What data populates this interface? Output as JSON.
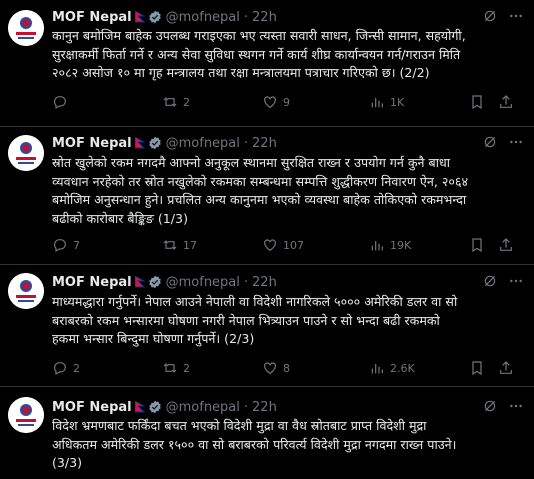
{
  "colors": {
    "background": "#000000",
    "text": "#e7e9ea",
    "muted": "#71767b",
    "divider": "#2f3336",
    "verified": "#829aab"
  },
  "tweets": [
    {
      "name": "MOF Nepal",
      "handle": "@mofnepal",
      "dot": "·",
      "time": "22h",
      "text": "कानुन बमोजिम बाहेक उपलब्ध गराइएका भए त्यस्ता सवारी साधन, जिन्सी सामान, सहयोगी,\nसुरक्षाकर्मी फिर्ता गर्ने र अन्य सेवा सुविधा स्थगन गर्ने कार्य शीघ्र कार्यान्वयन गर्न/गराउन मिति\n२०८२ असोज १० मा गृह मन्त्रालय तथा रक्षा मन्त्रालयमा पत्राचार गरिएको छ। (2/2)",
      "replies": "",
      "reposts": "2",
      "likes": "9",
      "views": "1K"
    },
    {
      "name": "MOF Nepal",
      "handle": "@mofnepal",
      "dot": "·",
      "time": "22h",
      "text": "स्रोत खुलेको रकम नगदमै आफ्नो अनुकूल स्थानमा सुरक्षित राख्न र उपयोग गर्न कुनै बाधा\nव्यवधान नरहेको तर स्रोत नखुलेको रकमका सम्बन्धमा सम्पत्ति शुद्धीकरण निवारण ऐन, २०६४\nबमोजिम अनुसन्धान हुने। प्रचलित अन्य कानुनमा भएको व्यवस्था बाहेक तोकिएको रकमभन्दा\nबढीको कारोबार बैङ्किङ (1/3)",
      "replies": "7",
      "reposts": "17",
      "likes": "107",
      "views": "19K"
    },
    {
      "name": "MOF Nepal",
      "handle": "@mofnepal",
      "dot": "·",
      "time": "22h",
      "text": "माध्यमद्धारा गर्नुपर्ने। नेपाल आउने नेपाली वा विदेशी नागरिकले ५००० अमेरिकी डलर वा सो\nबराबरको रकम भन्सारमा घोषणा नगरी नेपाल भित्र्याउन पाउने र सो भन्दा बढी रकमको\nहकमा भन्सार बिन्दुमा घोषणा गर्नुपर्ने। (2/3)",
      "replies": "2",
      "reposts": "2",
      "likes": "8",
      "views": "2.6K"
    },
    {
      "name": "MOF Nepal",
      "handle": "@mofnepal",
      "dot": "·",
      "time": "22h",
      "text": "विदेश भ्रमणबाट फर्किंदा बचत भएको विदेशी मुद्रा वा वैध स्रोतबाट प्राप्त विदेशी मुद्रा\nअधिकतम अमेरिकी डलर १५०० वा सो बराबरको परिवर्त्य विदेशी मुद्रा नगदमा राख्न पाउने।\n(3/3)"
    }
  ]
}
